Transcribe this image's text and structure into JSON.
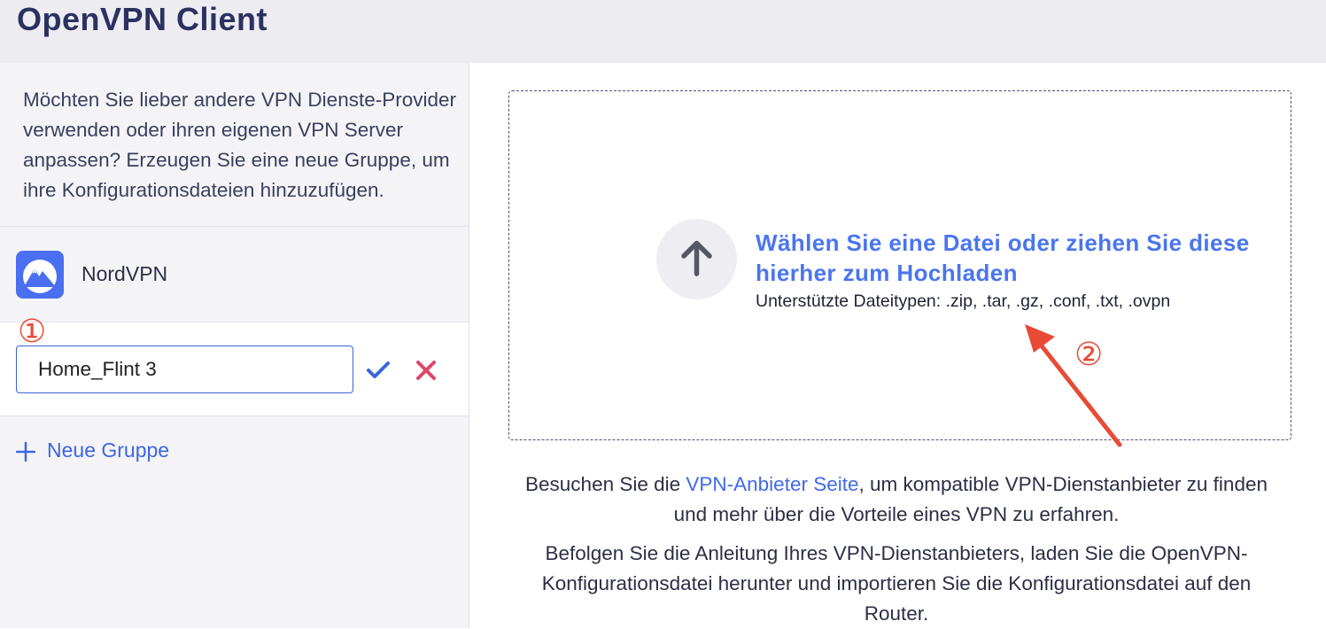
{
  "header": {
    "title": "OpenVPN Client"
  },
  "sidebar": {
    "intro_text": "Möchten Sie lieber andere VPN Dienste-Provider verwenden oder ihren eigenen VPN Server anpassen? Erzeugen Sie eine neue Gruppe, um ihre Konfigurationsdateien hinzuzufügen.",
    "provider": {
      "name": "NordVPN",
      "logo_icon": "nordvpn-logo-icon",
      "logo_color": "#4a6ff0"
    },
    "edit_group": {
      "annotation": "①",
      "value": "Home_Flint 3",
      "confirm_icon": "checkmark-icon",
      "cancel_icon": "close-icon"
    },
    "new_group_label": "Neue Gruppe"
  },
  "upload": {
    "title": "Wählen Sie eine Datei oder ziehen Sie diese hierher zum Hochladen",
    "types": "Unterstützte Dateitypen: .zip, .tar, .gz, .conf, .txt, .ovpn",
    "icon": "upload-arrow-icon",
    "annotation": "②"
  },
  "info": {
    "part1_before": "Besuchen Sie die ",
    "link": "VPN-Anbieter Seite",
    "part1_after": ", um kompatible VPN-Dienstanbieter zu finden und mehr über die Vorteile eines VPN zu erfahren.",
    "part2": "Befolgen Sie die Anleitung Ihres VPN-Dienstanbieters, laden Sie die OpenVPN-Konfigurationsdatei herunter und importieren Sie die Konfigurationsdatei auf den Router."
  },
  "colors": {
    "accent": "#4a75ef",
    "annotation": "#e84a36",
    "cancel": "#e0456a",
    "title": "#2c3160"
  }
}
